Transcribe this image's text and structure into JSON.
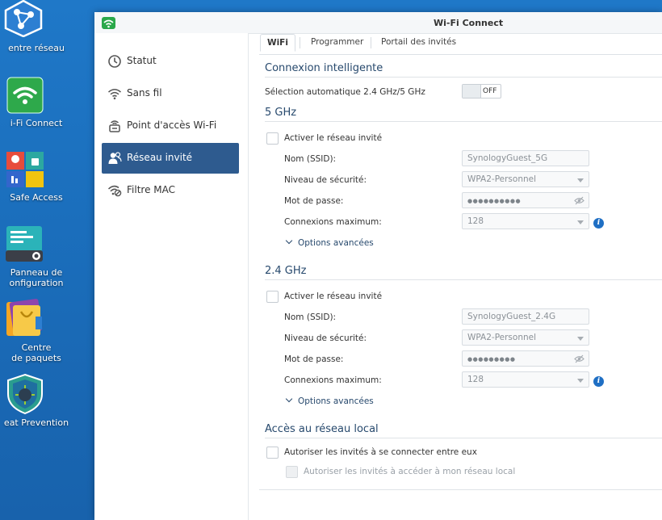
{
  "desktop": {
    "items": [
      {
        "label": "entre réseau"
      },
      {
        "label": "i-Fi Connect"
      },
      {
        "label": "Safe Access"
      },
      {
        "label": "Panneau de\nonfiguration"
      },
      {
        "label": "Centre\nde paquets"
      },
      {
        "label": "eat Prevention"
      }
    ]
  },
  "window": {
    "title": "Wi-Fi Connect"
  },
  "sidebar": {
    "items": [
      {
        "label": "Statut",
        "icon": "clock-icon"
      },
      {
        "label": "Sans fil",
        "icon": "wifi-icon"
      },
      {
        "label": "Point d'accès Wi-Fi",
        "icon": "router-icon"
      },
      {
        "label": "Réseau invité",
        "icon": "guest-user-icon",
        "active": true
      },
      {
        "label": "Filtre MAC",
        "icon": "wifi-filter-icon"
      }
    ]
  },
  "tabs": [
    {
      "label": "WiFi",
      "active": true
    },
    {
      "label": "Programmer"
    },
    {
      "label": "Portail des invités"
    }
  ],
  "smart": {
    "title": "Connexion intelligente",
    "auto_label": "Sélection automatique 2.4 GHz/5 GHz",
    "toggle_state": "OFF"
  },
  "band5": {
    "title": "5 GHz",
    "enable_label": "Activer le réseau invité",
    "ssid_label": "Nom (SSID):",
    "ssid_value": "SynologyGuest_5G",
    "security_label": "Niveau de sécurité:",
    "security_value": "WPA2-Personnel",
    "password_label": "Mot de passe:",
    "password_value": "●●●●●●●●●●",
    "max_label": "Connexions maximum:",
    "max_value": "128",
    "advanced_label": "Options avancées"
  },
  "band24": {
    "title": "2.4 GHz",
    "enable_label": "Activer le réseau invité",
    "ssid_label": "Nom (SSID):",
    "ssid_value": "SynologyGuest_2.4G",
    "security_label": "Niveau de sécurité:",
    "security_value": "WPA2-Personnel",
    "password_label": "Mot de passe:",
    "password_value": "●●●●●●●●●",
    "max_label": "Connexions maximum:",
    "max_value": "128",
    "advanced_label": "Options avancées"
  },
  "local": {
    "title": "Accès au réseau local",
    "allow_guests_label": "Autoriser les invités à se connecter entre eux",
    "allow_local_label": "Autoriser les invités à accéder à mon réseau local"
  },
  "colors": {
    "accent": "#2e5b8f",
    "section_title": "#27496d",
    "info": "#1f6fc4",
    "desktop_bg": "#1b6fbd"
  }
}
